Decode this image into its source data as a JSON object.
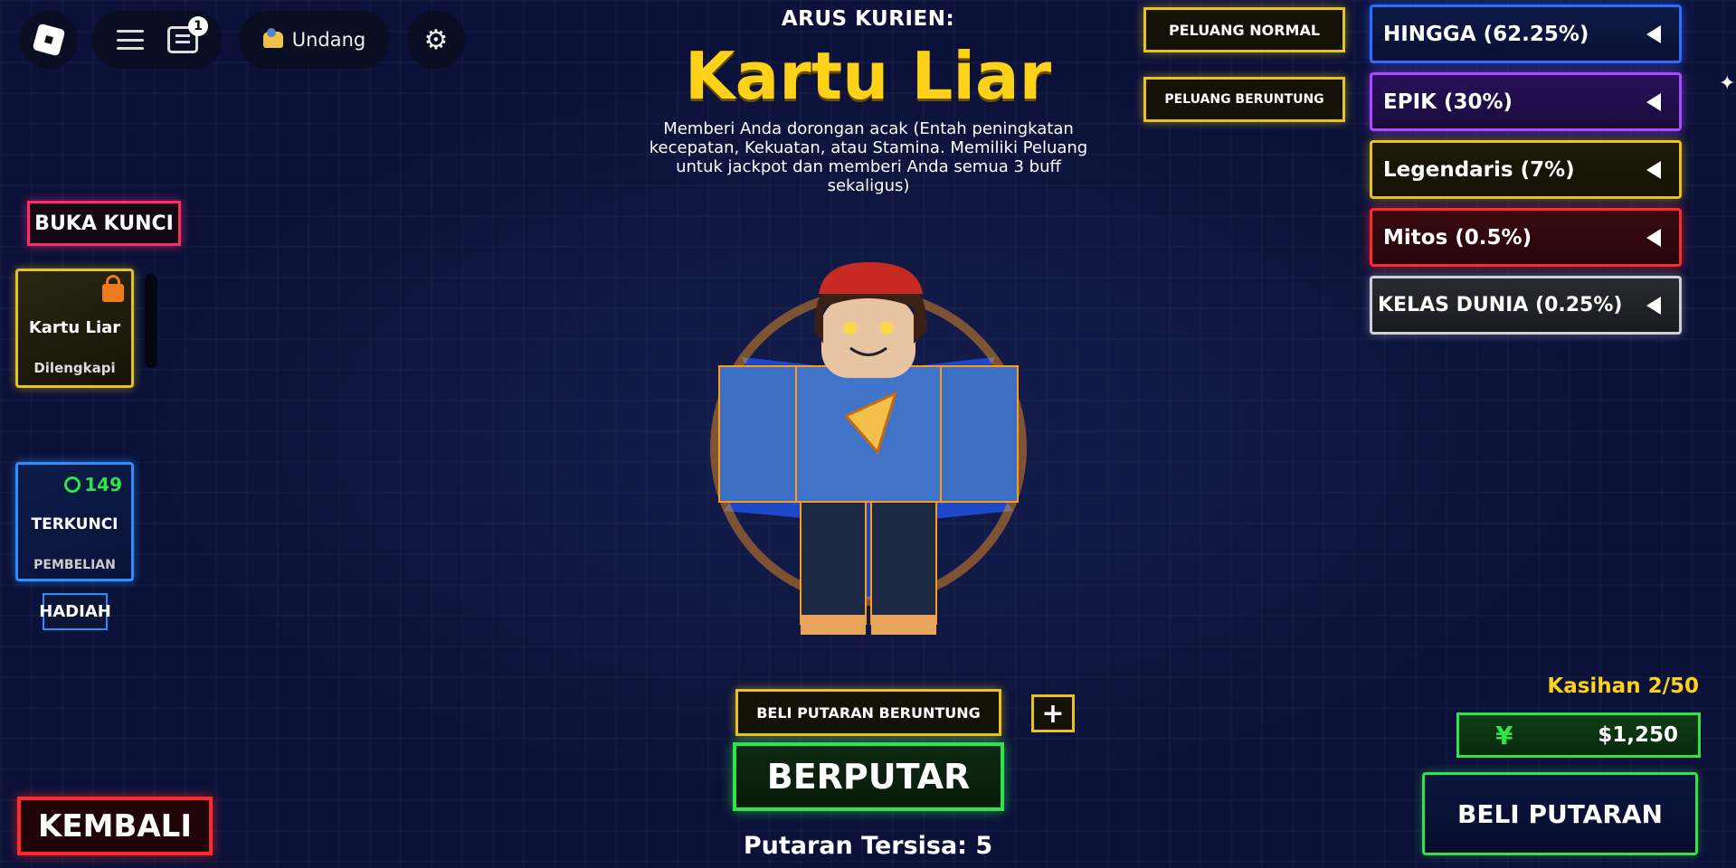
{
  "topbar": {
    "chat_badge": "1",
    "invite_label": "Undang"
  },
  "header": {
    "current_label": "ARUS KURIEN:",
    "title": "Kartu Liar",
    "description": "Memberi Anda dorongan acak (Entah peningkatan kecepatan, Kekuatan, atau Stamina. Memiliki Peluang untuk jackpot dan memberi Anda semua 3 buff sekaligus)"
  },
  "odds_buttons": {
    "normal": "PELUANG NORMAL",
    "lucky": "PELUANG BERUNTUNG"
  },
  "rarities": [
    {
      "label": "HINGGA (62.25%)",
      "color": "#2d6dff"
    },
    {
      "label": "EPIK (30%)",
      "color": "#a64bff"
    },
    {
      "label": "Legendaris (7%)",
      "color": "#e8c21f"
    },
    {
      "label": "Mitos (0.5%)",
      "color": "#ff2a2a"
    },
    {
      "label": "KELAS DUNIA (0.25%)",
      "color": "#cfcfd6"
    }
  ],
  "left_panel": {
    "unlock_label": "BUKA KUNCI",
    "slots": [
      {
        "name": "Kartu Liar",
        "status": "Dilengkapi"
      },
      {
        "price": "149",
        "name": "TERKUNCI",
        "status": "PEMBELIAN"
      }
    ],
    "gift_label": "HADIAH"
  },
  "spin": {
    "buy_lucky_label": "BELI PUTARAN BERUNTUNG",
    "plus_label": "+",
    "spin_label": "BERPUTAR",
    "remaining_label": "Putaran Tersisa: 5"
  },
  "back_label": "KEMBALI",
  "economy": {
    "pity_label": "Kasihan 2/50",
    "currency_symbol": "¥",
    "balance": "$1,250",
    "buy_spin_label": "BELI PUTARAN"
  }
}
